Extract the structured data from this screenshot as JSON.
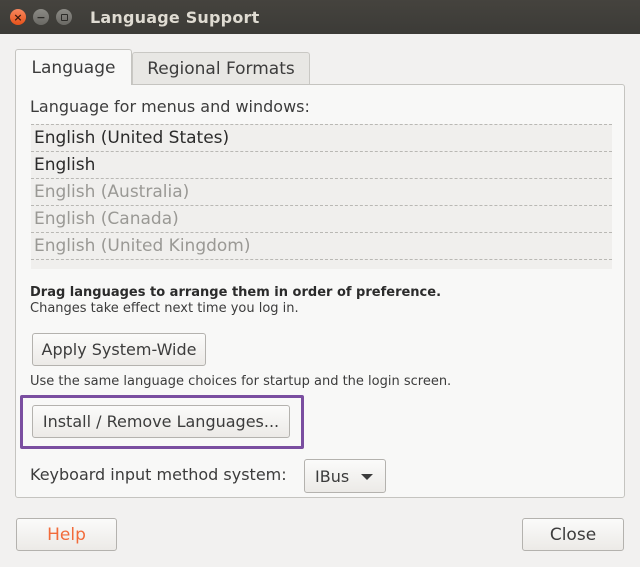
{
  "window": {
    "title": "Language Support",
    "close_glyph": "×",
    "minimize_glyph": "−"
  },
  "tabs": [
    {
      "label": "Language",
      "selected": true
    },
    {
      "label": "Regional Formats",
      "selected": false
    }
  ],
  "language": {
    "list_label": "Language for menus and windows:",
    "languages": [
      {
        "label": "English (United States)",
        "active": true
      },
      {
        "label": "English",
        "active": true
      },
      {
        "label": "English (Australia)",
        "active": false
      },
      {
        "label": "English (Canada)",
        "active": false
      },
      {
        "label": "English (United Kingdom)",
        "active": false
      }
    ],
    "drag_hint": "Drag languages to arrange them in order of preference.",
    "change_hint": "Changes take effect next time you log in.",
    "apply_button": "Apply System-Wide",
    "apply_hint": "Use the same language choices for startup and the login screen.",
    "install_button": "Install / Remove Languages...",
    "keyboard_label": "Keyboard input method system:",
    "keyboard_value": "IBus"
  },
  "footer": {
    "help_button": "Help",
    "close_button": "Close"
  },
  "colors": {
    "titlebar": "#3c3b37",
    "close_button": "#e6521a",
    "help_text": "#f26b3a",
    "highlight_border": "#7a4ea0"
  }
}
